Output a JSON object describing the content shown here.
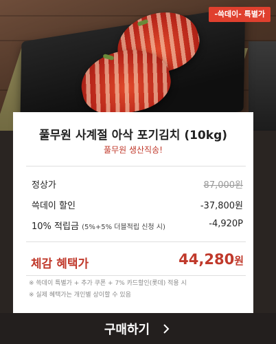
{
  "badge": {
    "label": "-쓱데이- 특별가"
  },
  "product": {
    "title": "풀무원 사계절 아삭 포기김치 (10kg)",
    "subtitle": "풀무원 생산직송!"
  },
  "price_rows": [
    {
      "label": "정상가",
      "note": "",
      "value": "87,000원",
      "struck": true
    },
    {
      "label": "쓱데이 할인",
      "note": "",
      "value": "-37,800원",
      "struck": false
    },
    {
      "label": "10% 적립금",
      "note": "(5%+5% 더블적립 신청 시)",
      "value": "-4,920P",
      "struck": false
    }
  ],
  "total": {
    "label": "체감 혜택가",
    "amount": "44,280",
    "unit": "원"
  },
  "notes": [
    "※ 쓱데이 특별가 + 추가 쿠폰 + 7% 카드할인(롯데) 적용 시",
    "※ 실제 혜택가는 개인별 상이할 수 있음"
  ],
  "cta": {
    "label": "구매하기",
    "icon": "chevron-right-icon"
  },
  "colors": {
    "accent": "#c0392b",
    "badge": "#e0402e",
    "button": "#231f1e"
  }
}
